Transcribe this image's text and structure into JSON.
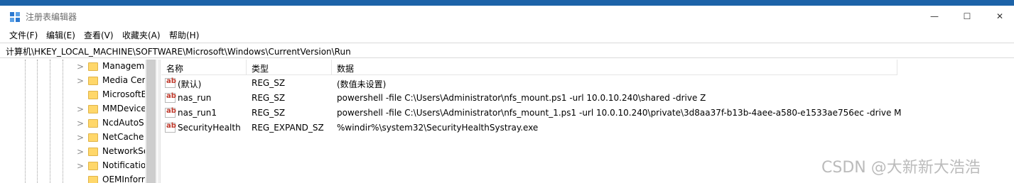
{
  "window": {
    "title": "注册表编辑器",
    "controls": {
      "minimize": "—",
      "maximize": "☐",
      "close": "✕"
    }
  },
  "menu": [
    "文件(F)",
    "编辑(E)",
    "查看(V)",
    "收藏夹(A)",
    "帮助(H)"
  ],
  "address": "计算机\\HKEY_LOCAL_MACHINE\\SOFTWARE\\Microsoft\\Windows\\CurrentVersion\\Run",
  "tree": {
    "items": [
      {
        "label": "Managem",
        "expander": ">"
      },
      {
        "label": "Media Cer",
        "expander": ">"
      },
      {
        "label": "MicrosoftE",
        "expander": ""
      },
      {
        "label": "MMDevice",
        "expander": ">"
      },
      {
        "label": "NcdAutoS",
        "expander": ">"
      },
      {
        "label": "NetCache",
        "expander": ">"
      },
      {
        "label": "NetworkSe",
        "expander": ">"
      },
      {
        "label": "Notification",
        "expander": ">"
      },
      {
        "label": "OEMInforr",
        "expander": ""
      }
    ]
  },
  "list": {
    "headers": {
      "name": "名称",
      "type": "类型",
      "data": "数据"
    },
    "rows": [
      {
        "name": "(默认)",
        "type": "REG_SZ",
        "data": "(数值未设置)"
      },
      {
        "name": "nas_run",
        "type": "REG_SZ",
        "data": "powershell -file C:\\Users\\Administrator\\nfs_mount.ps1 -url 10.0.10.240\\shared -drive Z"
      },
      {
        "name": "nas_run1",
        "type": "REG_SZ",
        "data": "powershell -file C:\\Users\\Administrator\\nfs_mount_1.ps1 -url 10.0.10.240\\private\\3d8aa37f-b13b-4aee-a580-e1533ae756ec -drive M"
      },
      {
        "name": "SecurityHealth",
        "type": "REG_EXPAND_SZ",
        "data": "%windir%\\system32\\SecurityHealthSystray.exe"
      }
    ],
    "value_icon_text": "ab"
  },
  "watermark": "CSDN @大新新大浩浩",
  "colors": {
    "title_strip": "#1c63a8",
    "folder": "#ffd76a",
    "ab_icon": "#c0392b"
  }
}
